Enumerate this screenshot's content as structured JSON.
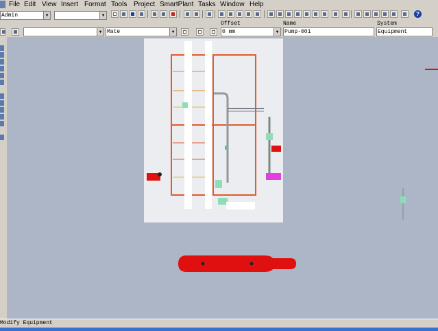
{
  "menubar": {
    "items": [
      "File",
      "Edit",
      "View",
      "Insert",
      "Format",
      "Tools",
      "Project",
      "SmartPlant",
      "Tasks",
      "Window",
      "Help"
    ]
  },
  "toolbar": {
    "user_combo": "Admin",
    "second_combo": "",
    "help_label": "?"
  },
  "properties_bar": {
    "headers": {
      "offset": "Offset",
      "name": "Name",
      "system": "System"
    },
    "first_combo": "",
    "mate_combo": "Mate",
    "offset_value": "0 mm",
    "name_value": "Pump-001",
    "system_value": "Equipment"
  },
  "status": {
    "text": "Modify Equipment"
  },
  "colors": {
    "canvas_bg": "#adb6c7",
    "frame": "#e05a2a",
    "sheet": "#ecedf1",
    "vessel": "#e11010",
    "equipment_green": "#8fdcb8",
    "selection": "#e040e0"
  },
  "icons": [
    "app-icon",
    "new-icon",
    "open-icon",
    "save-icon",
    "print-icon",
    "cut-icon",
    "copy-icon",
    "delete-icon",
    "undo-icon",
    "select-icon",
    "zoom-icon",
    "help-icon"
  ]
}
